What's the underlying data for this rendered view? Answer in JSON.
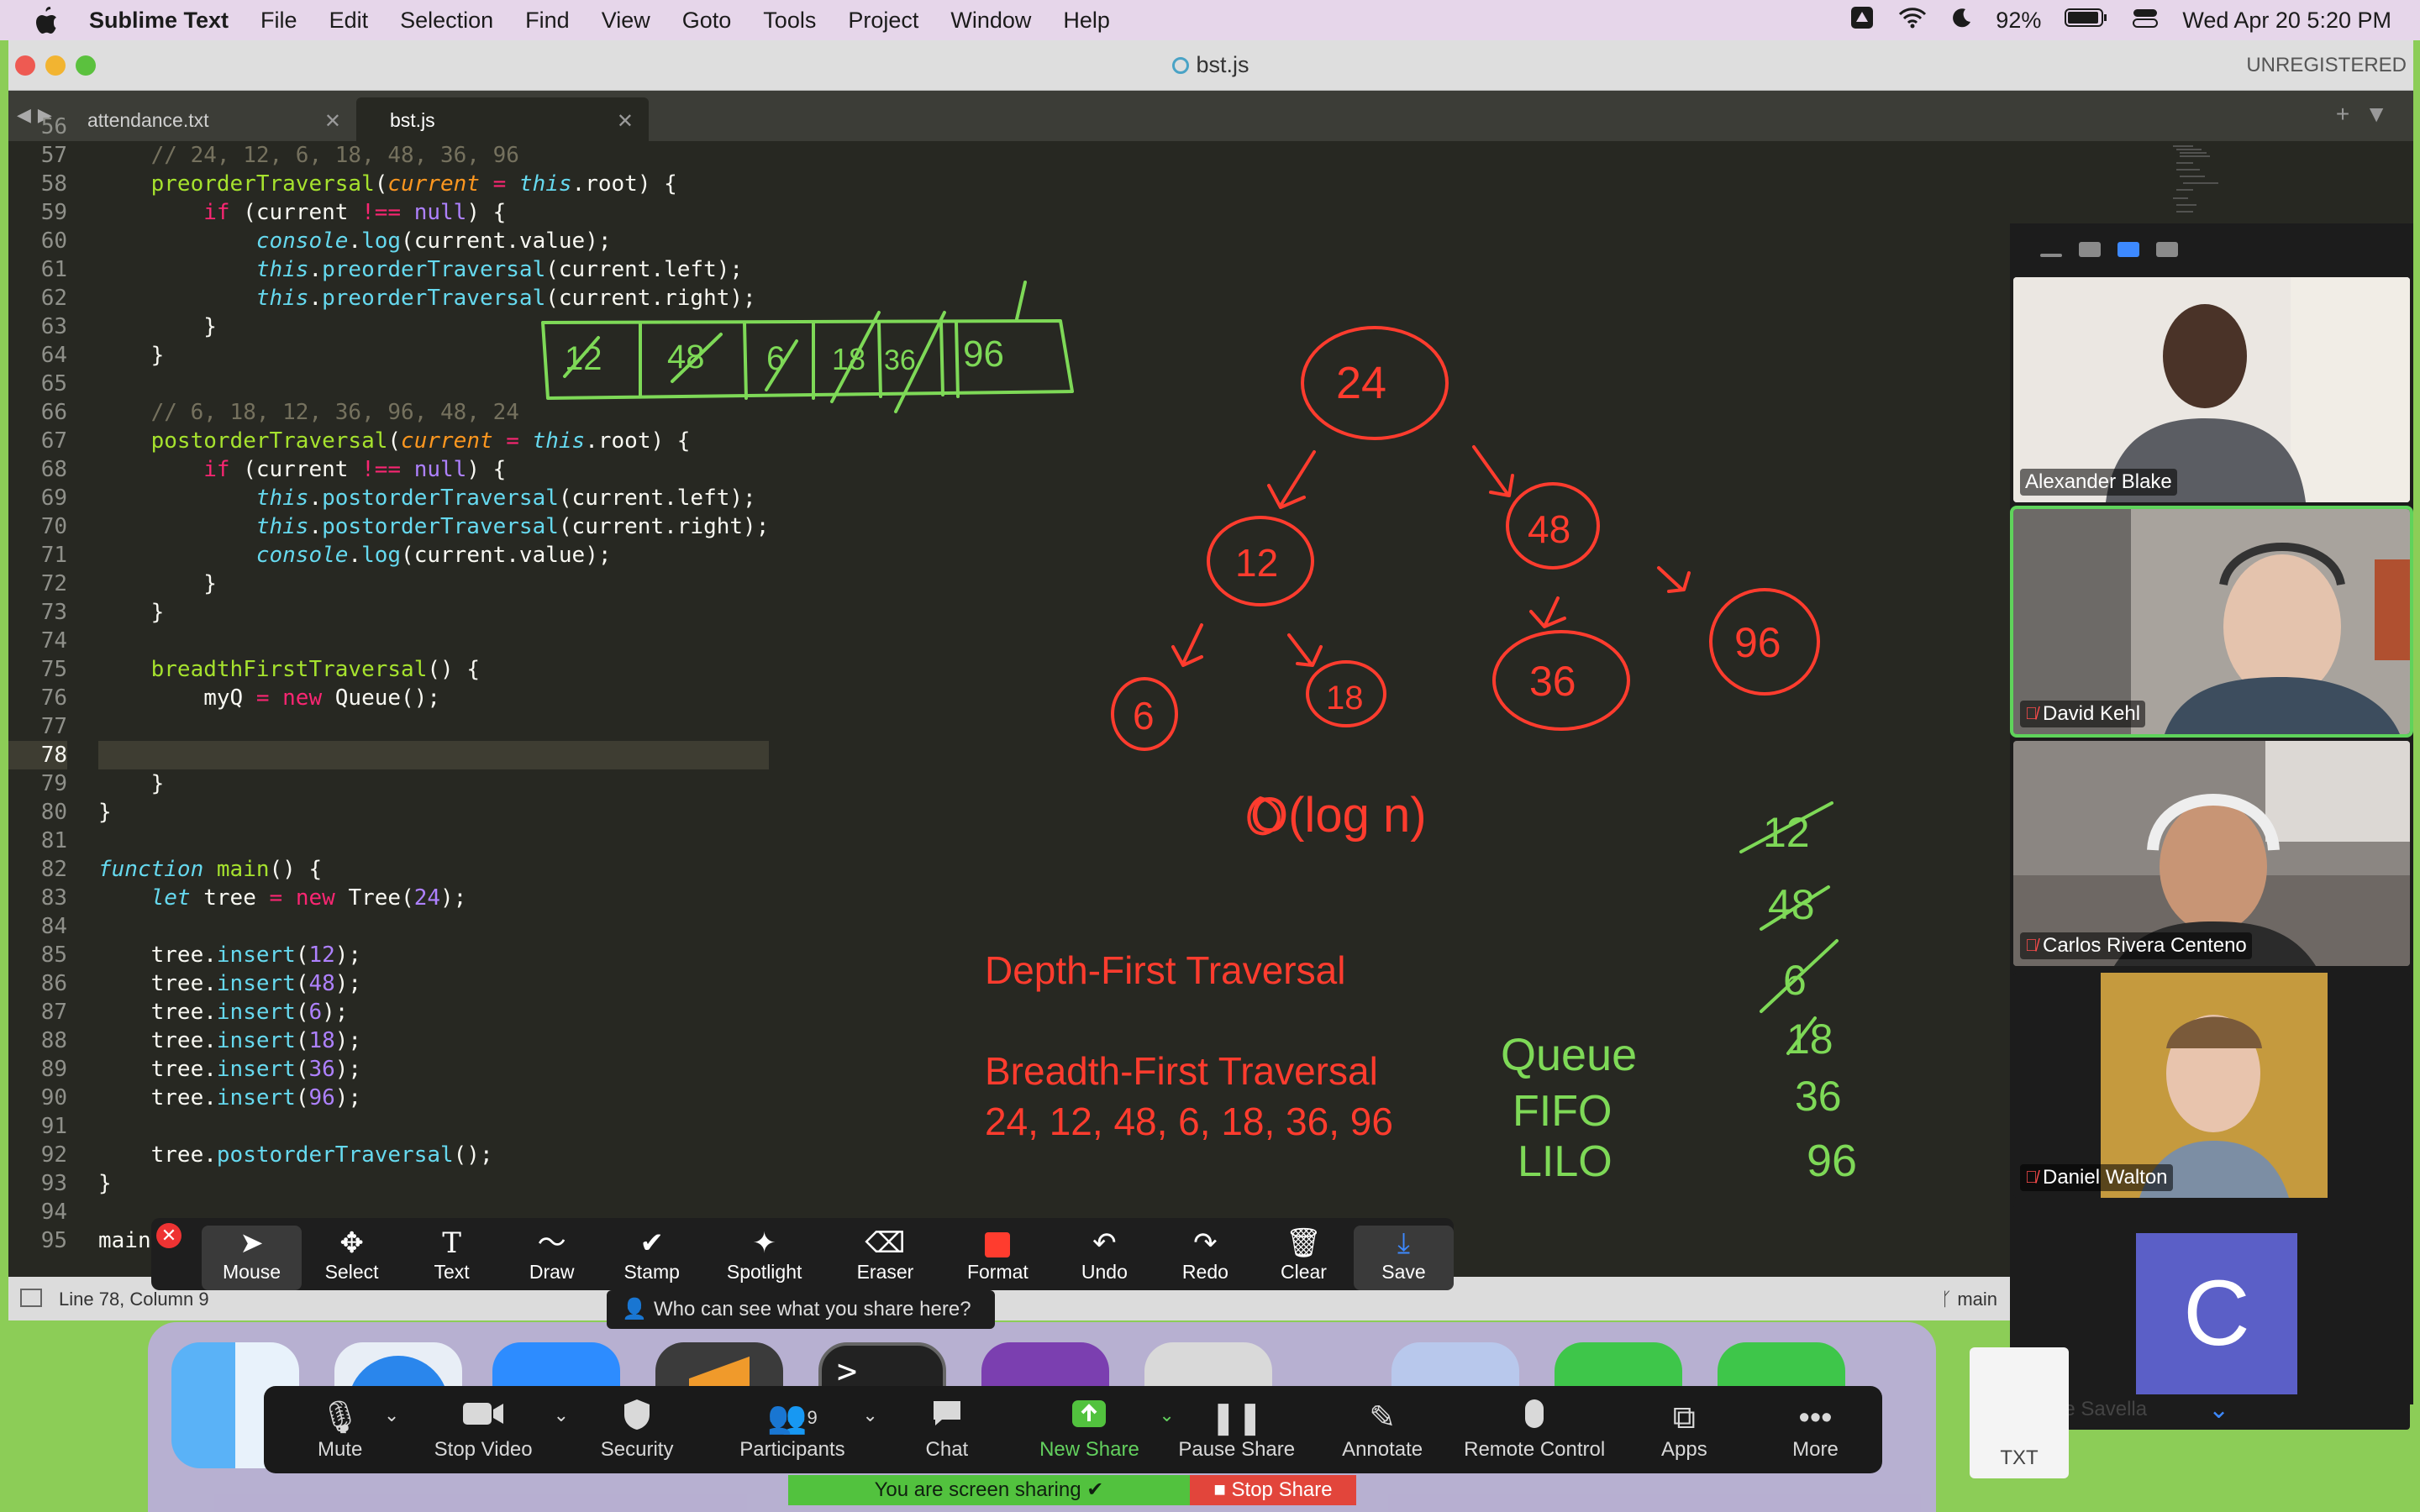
{
  "menubar": {
    "app_name": "Sublime Text",
    "items": [
      "File",
      "Edit",
      "Selection",
      "Find",
      "View",
      "Goto",
      "Tools",
      "Project",
      "Window",
      "Help"
    ],
    "battery": "92%",
    "datetime": "Wed Apr 20  5:20 PM"
  },
  "window": {
    "title": "bst.js",
    "unregistered": "UNREGISTERED",
    "tabs": [
      {
        "label": "attendance.txt",
        "active": false
      },
      {
        "label": "bst.js",
        "active": true
      }
    ]
  },
  "editor": {
    "current_line": 78,
    "line_numbers": [
      56,
      57,
      58,
      59,
      60,
      61,
      62,
      63,
      64,
      65,
      66,
      67,
      68,
      69,
      70,
      71,
      72,
      73,
      74,
      75,
      76,
      77,
      78,
      79,
      80,
      81,
      82,
      83,
      84,
      85,
      86,
      87,
      88,
      89,
      90,
      91,
      92,
      93,
      94,
      95
    ]
  },
  "statusbar": {
    "position": "Line 78, Column 9",
    "branch": "main"
  },
  "annotations": {
    "tree_nodes": [
      "24",
      "12",
      "48",
      "6",
      "18",
      "36",
      "96"
    ],
    "array_cells": [
      "12",
      "48",
      "6",
      "18",
      "36",
      "96"
    ],
    "big_o": "O(log n)",
    "queue_words": [
      "Queue",
      "FIFO",
      "LILO"
    ],
    "queue_values": [
      "12",
      "48",
      "6",
      "18",
      "36",
      "96"
    ],
    "depth_first": "Depth-First Traversal",
    "breadth_first": "Breadth-First Traversal",
    "bfs_order": "24, 12, 48, 6, 18, 36, 96",
    "ink_red": "#ff3c2e",
    "ink_green": "#7ed957"
  },
  "gallery": {
    "participants": [
      {
        "name": "Alexander Blake",
        "muted": false
      },
      {
        "name": "David Kehl",
        "muted": true,
        "speaking": true
      },
      {
        "name": "Carlos Rivera Centeno",
        "muted": true
      },
      {
        "name": "Daniel Walton",
        "muted": true
      },
      {
        "name": "Joe Savella",
        "muted": true,
        "initial": "C"
      }
    ]
  },
  "annotate_toolbar": {
    "tools": [
      "Mouse",
      "Select",
      "Text",
      "Draw",
      "Stamp",
      "Spotlight",
      "Eraser",
      "Format",
      "Undo",
      "Redo",
      "Clear",
      "Save"
    ],
    "who_can_see": "Who can see what you share here?"
  },
  "meeting_controls": {
    "mute": "Mute",
    "stop_video": "Stop Video",
    "security": "Security",
    "participants": "Participants",
    "participants_count": "9",
    "chat": "Chat",
    "new_share": "New Share",
    "pause_share": "Pause Share",
    "annotate": "Annotate",
    "remote_control": "Remote Control",
    "apps": "Apps",
    "more": "More",
    "sharing_label": "You are screen sharing",
    "stop_share": "Stop Share"
  },
  "dock": {
    "txt_label": "TXT"
  }
}
